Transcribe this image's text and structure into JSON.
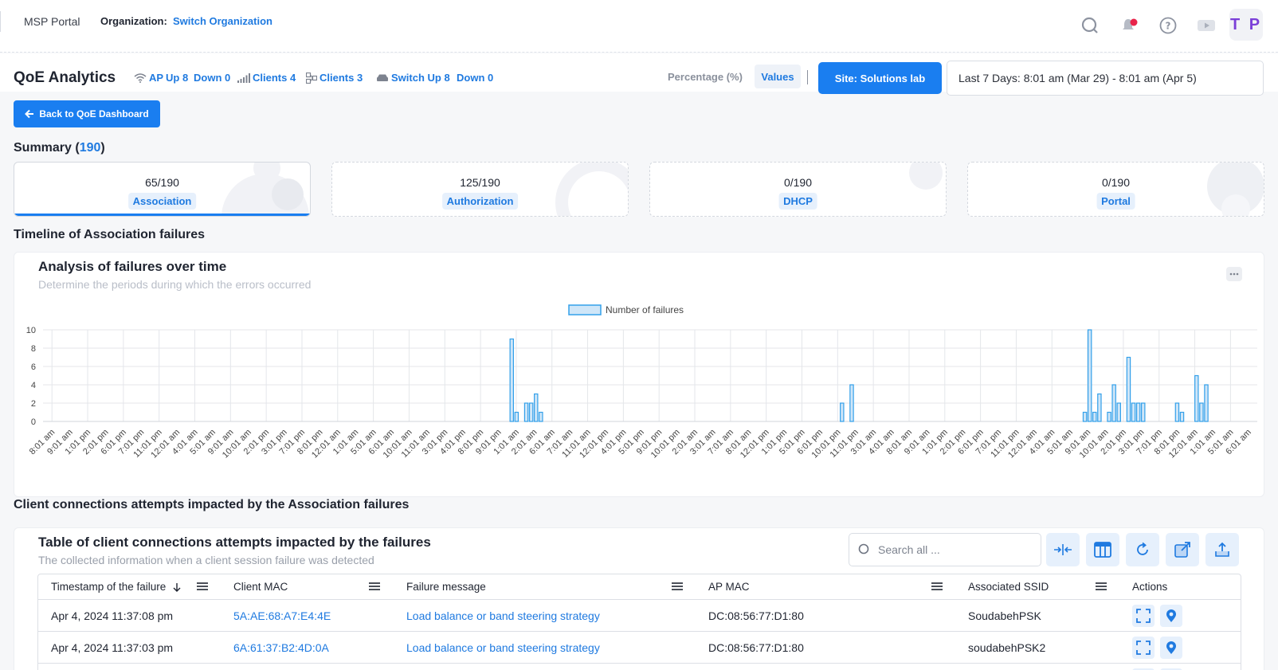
{
  "topbar": {
    "brand": "MSP Portal",
    "org_label": "Organization:",
    "org_link": "Switch Organization",
    "avatar": "T P",
    "icons": [
      "search-icon",
      "bell-icon",
      "help-icon",
      "video-icon"
    ]
  },
  "header": {
    "title": "QoE Analytics",
    "stats": {
      "ap_label": "AP",
      "ap_up": "Up 8",
      "ap_down": "Down 0",
      "wireless_clients": "Clients 4",
      "wired_clients": "Clients 3",
      "switch_up": "Switch Up 8",
      "switch_down": "Down 0"
    },
    "percentage_label": "Percentage (%)",
    "values_label": "Values",
    "site_button": "Site: Solutions lab",
    "date_range": "Last 7 Days: 8:01 am (Mar 29) - 8:01 am (Apr 5)"
  },
  "back_button": "Back to QoE Dashboard",
  "summary": {
    "title": "Summary (",
    "count": "190",
    "close": ")",
    "cards": [
      {
        "value": "65/190",
        "label": "Association"
      },
      {
        "value": "125/190",
        "label": "Authorization"
      },
      {
        "value": "0/190",
        "label": "DHCP"
      },
      {
        "value": "0/190",
        "label": "Portal"
      }
    ]
  },
  "timeline_title": "Timeline of Association failures",
  "chart_panel": {
    "title": "Analysis of failures over time",
    "subtitle": "Determine the periods during which the errors occurred"
  },
  "chart_data": {
    "type": "bar",
    "series": [
      {
        "name": "Number of failures",
        "values": [
          0,
          0,
          0,
          0,
          0,
          0,
          0,
          0,
          0,
          0,
          0,
          0,
          0,
          0,
          0,
          0,
          0,
          0,
          0,
          0,
          0,
          0,
          0,
          0,
          0,
          0,
          0,
          0,
          0,
          0,
          0,
          0,
          0,
          0,
          0,
          0,
          0,
          0,
          0,
          0,
          0,
          0,
          0,
          0,
          0,
          0,
          0,
          0,
          0,
          0,
          0,
          0,
          0,
          0,
          0,
          0,
          0,
          0,
          0,
          0,
          0,
          0,
          0,
          0,
          0,
          0,
          0,
          0,
          0,
          0,
          0,
          0,
          0,
          0,
          0,
          0,
          0,
          0,
          0,
          0,
          0,
          0,
          0,
          0,
          0,
          0,
          0,
          0,
          0,
          0,
          0,
          0,
          0,
          0,
          0,
          0,
          9,
          1,
          0,
          2,
          2,
          3,
          1,
          0,
          0,
          0,
          0,
          0,
          0,
          0,
          0,
          0,
          0,
          0,
          0,
          0,
          0,
          0,
          0,
          0,
          0,
          0,
          0,
          0,
          0,
          0,
          0,
          0,
          0,
          0,
          0,
          0,
          0,
          0,
          0,
          0,
          0,
          0,
          0,
          0,
          0,
          0,
          0,
          0,
          0,
          0,
          0,
          0,
          0,
          0,
          0,
          0,
          0,
          0,
          0,
          0,
          0,
          0,
          0,
          0,
          0,
          0,
          0,
          0,
          2,
          0,
          4,
          0,
          0,
          0,
          0,
          0,
          0,
          0,
          0,
          0,
          0,
          0,
          0,
          0,
          0,
          0,
          0,
          0,
          0,
          0,
          0,
          0,
          0,
          0,
          0,
          0,
          0,
          0,
          0,
          0,
          0,
          0,
          0,
          0,
          0,
          0,
          0,
          0,
          0,
          0,
          0,
          0,
          0,
          0,
          0,
          0,
          0,
          0,
          1,
          10,
          1,
          3,
          0,
          1,
          4,
          2,
          0,
          7,
          2,
          2,
          2,
          0,
          0,
          0,
          0,
          0,
          0,
          2,
          1,
          0,
          0,
          5,
          2,
          4,
          0,
          0,
          0,
          0,
          0,
          0,
          0,
          0,
          0,
          0
        ],
        "color": "#33a0ea",
        "fill": "#cfe6f8"
      }
    ],
    "x_start": "8:01 am",
    "x_step_hours": 1,
    "tick_labels": [
      "8:01 am",
      "9:01 am",
      "1:01 pm",
      "2:01 pm",
      "6:01 pm",
      "7:01 pm",
      "11:01 pm",
      "12:01 am",
      "4:01 am",
      "5:01 am",
      "9:01 am",
      "10:01 am",
      "2:01 pm",
      "3:01 pm",
      "7:01 pm",
      "8:01 pm",
      "12:01 am",
      "1:01 am",
      "5:01 am",
      "6:01 am",
      "10:01 am",
      "11:01 am",
      "3:01 pm",
      "4:01 pm",
      "8:01 pm",
      "9:01 pm",
      "1:01 am",
      "2:01 am",
      "6:01 am",
      "7:01 am",
      "11:01 am",
      "12:01 pm",
      "4:01 pm",
      "5:01 pm",
      "9:01 pm",
      "10:01 pm",
      "2:01 am",
      "3:01 am",
      "7:01 am",
      "8:01 am",
      "12:01 pm",
      "1:01 pm",
      "5:01 pm",
      "6:01 pm",
      "10:01 pm",
      "11:01 pm",
      "3:01 am",
      "4:01 am",
      "8:01 am",
      "9:01 am",
      "1:01 pm",
      "2:01 pm",
      "6:01 pm",
      "7:01 pm",
      "11:01 pm",
      "12:01 am",
      "4:01 am",
      "5:01 am",
      "9:01 am",
      "10:01 am",
      "2:01 pm",
      "3:01 pm",
      "7:01 pm",
      "8:01 pm",
      "12:01 am",
      "1:01 am",
      "5:01 am",
      "6:01 am"
    ],
    "y_ticks": [
      "0",
      "2",
      "4",
      "6",
      "8",
      "10"
    ],
    "ylim": [
      0,
      10
    ],
    "legend": "top-center",
    "grid": true
  },
  "impact_title": "Client connections attempts impacted by the Association failures",
  "table_panel": {
    "title": "Table of client connections attempts impacted by the failures",
    "subtitle": "The collected information when a client session failure was detected",
    "search_placeholder": "Search all ...",
    "columns": [
      "Timestamp of the failure",
      "Client MAC",
      "Failure message",
      "AP MAC",
      "Associated SSID",
      "Actions"
    ],
    "rows": [
      {
        "timestamp": "Apr 4, 2024 11:37:08 pm",
        "client_mac": "5A:AE:68:A7:E4:4E",
        "message": "Load balance or band steering strategy",
        "ap_mac": "DC:08:56:77:D1:80",
        "ssid": "SoudabehPSK"
      },
      {
        "timestamp": "Apr 4, 2024 11:37:03 pm",
        "client_mac": "6A:61:37:B2:4D:0A",
        "message": "Load balance or band steering strategy",
        "ap_mac": "DC:08:56:77:D1:80",
        "ssid": "soudabehPSK2"
      }
    ]
  }
}
